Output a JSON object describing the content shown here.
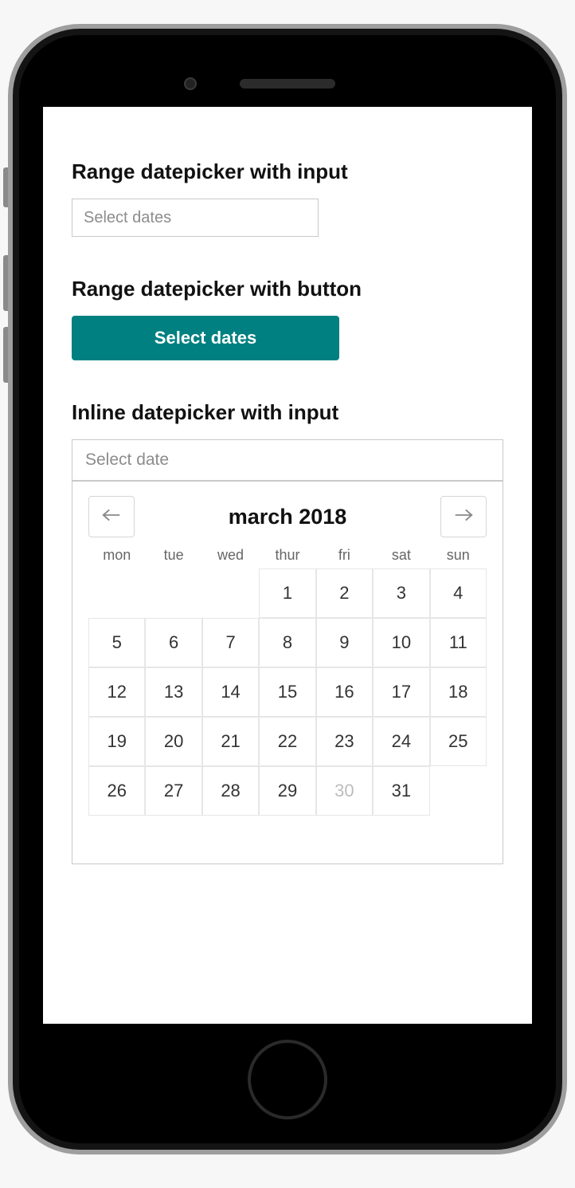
{
  "sections": {
    "rangeInput": {
      "title": "Range datepicker with input",
      "placeholder": "Select dates"
    },
    "rangeButton": {
      "title": "Range datepicker with button",
      "buttonLabel": "Select dates"
    },
    "inline": {
      "title": "Inline datepicker with input",
      "placeholder": "Select date"
    }
  },
  "calendar": {
    "title": "march 2018",
    "weekdays": [
      "mon",
      "tue",
      "wed",
      "thur",
      "fri",
      "sat",
      "sun"
    ],
    "leadingBlanks": 3,
    "days": [
      1,
      2,
      3,
      4,
      5,
      6,
      7,
      8,
      9,
      10,
      11,
      12,
      13,
      14,
      15,
      16,
      17,
      18,
      19,
      20,
      21,
      22,
      23,
      24,
      25,
      26,
      27,
      28,
      29,
      30,
      31
    ],
    "mutedDays": [
      30
    ]
  },
  "colors": {
    "primary": "#008080"
  }
}
